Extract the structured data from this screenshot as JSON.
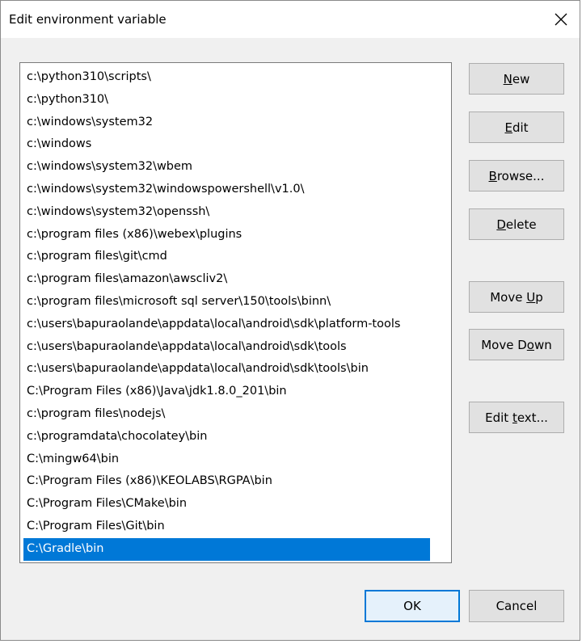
{
  "window": {
    "title": "Edit environment variable"
  },
  "paths": [
    "c:\\python310\\scripts\\",
    "c:\\python310\\",
    "c:\\windows\\system32",
    "c:\\windows",
    "c:\\windows\\system32\\wbem",
    "c:\\windows\\system32\\windowspowershell\\v1.0\\",
    "c:\\windows\\system32\\openssh\\",
    "c:\\program files (x86)\\webex\\plugins",
    "c:\\program files\\git\\cmd",
    "c:\\program files\\amazon\\awscliv2\\",
    "c:\\program files\\microsoft sql server\\150\\tools\\binn\\",
    "c:\\users\\bapuraolande\\appdata\\local\\android\\sdk\\platform-tools",
    "c:\\users\\bapuraolande\\appdata\\local\\android\\sdk\\tools",
    "c:\\users\\bapuraolande\\appdata\\local\\android\\sdk\\tools\\bin",
    "C:\\Program Files (x86)\\Java\\jdk1.8.0_201\\bin",
    "c:\\program files\\nodejs\\",
    "c:\\programdata\\chocolatey\\bin",
    "C:\\mingw64\\bin",
    "C:\\Program Files (x86)\\KEOLABS\\RGPA\\bin",
    "C:\\Program Files\\CMake\\bin",
    "C:\\Program Files\\Git\\bin",
    "C:\\Gradle\\bin"
  ],
  "selected_index": 21,
  "buttons": {
    "new": {
      "pre": "",
      "key": "N",
      "post": "ew"
    },
    "edit": {
      "pre": "",
      "key": "E",
      "post": "dit"
    },
    "browse": {
      "pre": "",
      "key": "B",
      "post": "rowse..."
    },
    "delete": {
      "pre": "",
      "key": "D",
      "post": "elete"
    },
    "move_up": {
      "pre": "Move ",
      "key": "U",
      "post": "p"
    },
    "move_down": {
      "pre": "Move D",
      "key": "o",
      "post": "wn"
    },
    "edit_text": {
      "pre": "Edit ",
      "key": "t",
      "post": "ext..."
    },
    "ok": "OK",
    "cancel": "Cancel"
  },
  "colors": {
    "selection": "#0078d7",
    "dialog_bg": "#f0f0f0"
  }
}
